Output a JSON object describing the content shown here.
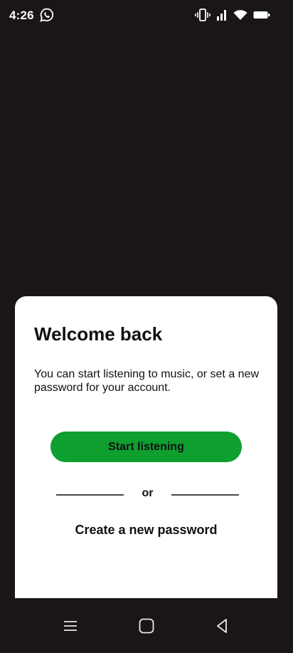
{
  "status_bar": {
    "time": "4:26",
    "icons": [
      "whatsapp-icon",
      "vibrate-icon",
      "signal-icon",
      "wifi-icon",
      "battery-icon"
    ]
  },
  "card": {
    "title": "Welcome back",
    "subtitle": "You can start listening to music, or set a new password for your account.",
    "primary_button_label": "Start listening",
    "divider_text": "or",
    "secondary_link_label": "Create a new password"
  },
  "nav_bar": {
    "icons": [
      "menu-icon",
      "home-icon",
      "back-icon"
    ]
  },
  "colors": {
    "background": "#1a1616",
    "card": "#ffffff",
    "accent": "#0e9f2f",
    "text": "#111111"
  }
}
